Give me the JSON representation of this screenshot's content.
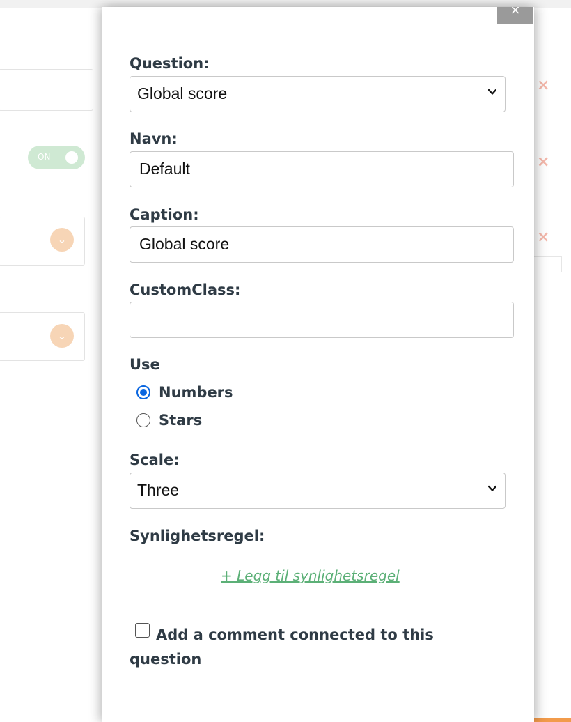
{
  "dialog": {
    "close_label": "×",
    "question": {
      "label": "Question:",
      "selected": "Global score"
    },
    "name": {
      "label": "Navn:",
      "value": "Default"
    },
    "caption": {
      "label": "Caption:",
      "value": "Global score"
    },
    "custom_class": {
      "label": "CustomClass:",
      "value": ""
    },
    "use": {
      "label": "Use",
      "options": [
        {
          "label": "Numbers",
          "checked": true
        },
        {
          "label": "Stars",
          "checked": false
        }
      ]
    },
    "scale": {
      "label": "Scale:",
      "selected": "Three"
    },
    "visibility": {
      "label": "Synlighetsregel:",
      "add_link": "+ Legg til synlighetsregel"
    },
    "comment_checkbox": {
      "label": "Add a comment connected to this question",
      "checked": false
    }
  },
  "background": {
    "toggle_label": "ON",
    "chevron_icon": "⌄",
    "delete_icon": "×"
  },
  "colors": {
    "accent_green": "#5cb077",
    "radio_blue": "#0a66e0",
    "bg_orange": "#f29b4b",
    "label_text": "#2f3b45"
  }
}
